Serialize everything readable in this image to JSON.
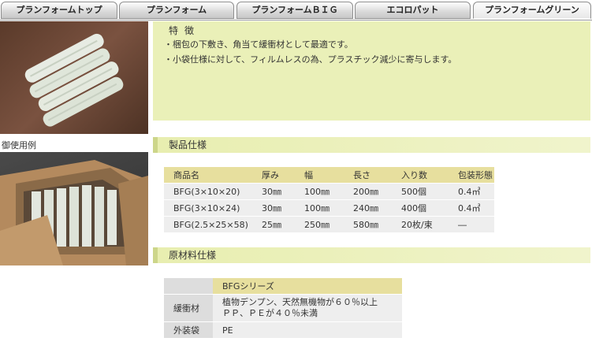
{
  "tabs": [
    {
      "label": "プランフォームトップ",
      "active": false
    },
    {
      "label": "プランフォーム",
      "active": false
    },
    {
      "label": "プランフォームＢＩＧ",
      "active": false
    },
    {
      "label": "エコロパット",
      "active": false
    },
    {
      "label": "プランフォームグリーン",
      "active": true
    }
  ],
  "features": {
    "title": "特徴",
    "bullets": [
      "・梱包の下敷き、角当て緩衝材として最適です。",
      "・小袋仕様に対して、フィルムレスの為、プラスチック減少に寄与します。"
    ]
  },
  "usage_caption": "御使用例",
  "spec": {
    "title": "製品仕様",
    "headers": [
      "商品名",
      "厚み",
      "幅",
      "長さ",
      "入り数",
      "包装形態"
    ],
    "rows": [
      [
        "BFG(3×10×20)",
        "30㎜",
        "100㎜",
        "200㎜",
        "500個",
        "0.4㎥"
      ],
      [
        "BFG(3×10×24)",
        "30㎜",
        "100㎜",
        "240㎜",
        "400個",
        "0.4㎥"
      ],
      [
        "BFG(2.5×25×58)",
        "25㎜",
        "250㎜",
        "580㎜",
        "20枚/束",
        "―"
      ]
    ]
  },
  "materials": {
    "title": "原材料仕様",
    "series_header": "BFGシリーズ",
    "rows": [
      {
        "label": "緩衝材",
        "lines": [
          "植物デンプン、天然無機物が６０％以上",
          "ＰＰ、ＰＥが４０％未満"
        ]
      },
      {
        "label": "外装袋",
        "lines": [
          "PE"
        ]
      }
    ]
  }
}
